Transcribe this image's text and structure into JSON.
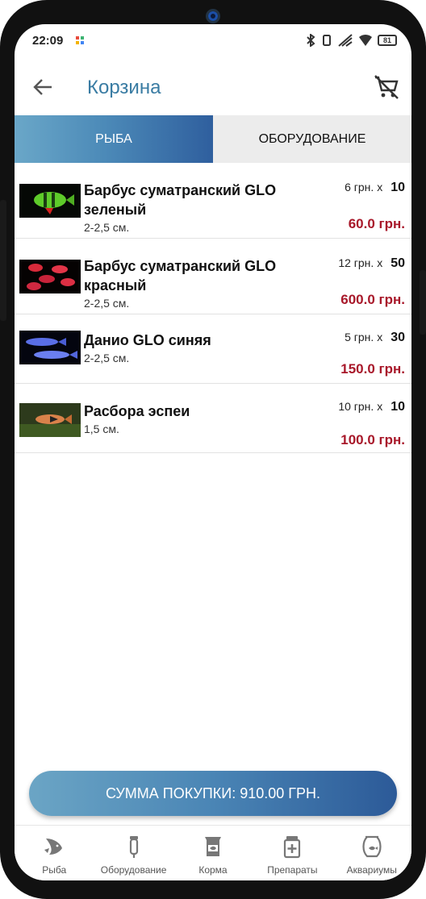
{
  "status": {
    "time": "22:09",
    "battery": "81"
  },
  "appbar": {
    "title": "Корзина"
  },
  "tabs": [
    {
      "label": "РЫБА",
      "active": true
    },
    {
      "label": "ОБОРУДОВАНИЕ",
      "active": false
    }
  ],
  "items": [
    {
      "name": "Барбус суматранский GLO зеленый",
      "size": "2-2,5 см.",
      "unit_price": "6 грн. x",
      "qty": "10",
      "total": "60.0 грн."
    },
    {
      "name": "Барбус суматранский GLO красный",
      "size": "2-2,5 см.",
      "unit_price": "12 грн. x",
      "qty": "50",
      "total": "600.0 грн."
    },
    {
      "name": "Данио GLO синяя",
      "size": "2-2,5 см.",
      "unit_price": "5 грн. x",
      "qty": "30",
      "total": "150.0 грн."
    },
    {
      "name": "Расбора эспеи",
      "size": "1,5 см.",
      "unit_price": "10 грн. x",
      "qty": "10",
      "total": "100.0 грн."
    }
  ],
  "summary": {
    "label": "СУММА ПОКУПКИ: 910.00 ГРН."
  },
  "bottomnav": [
    {
      "label": "Рыба",
      "icon": "fish-icon"
    },
    {
      "label": "Оборудование",
      "icon": "equipment-icon"
    },
    {
      "label": "Корма",
      "icon": "food-icon"
    },
    {
      "label": "Препараты",
      "icon": "medicine-icon"
    },
    {
      "label": "Аквариумы",
      "icon": "aquarium-icon"
    }
  ],
  "colors": {
    "accent": "#3a7ca3",
    "price": "#a8182a",
    "tab_gradient_end": "#2f5f9e"
  }
}
